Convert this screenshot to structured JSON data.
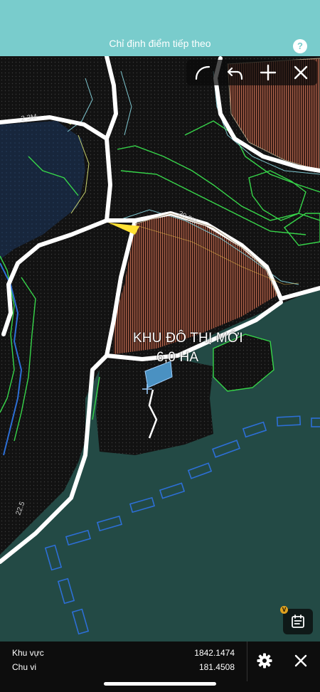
{
  "header": {
    "title": "Chỉ định điểm tiếp theo",
    "help_label": "?"
  },
  "toolbar": {
    "tools": [
      {
        "name": "arc-icon"
      },
      {
        "name": "undo-icon"
      },
      {
        "name": "plus-icon"
      },
      {
        "name": "close-icon"
      }
    ]
  },
  "map": {
    "area_title": "KHU ĐÔ THỊ MỚI",
    "area_size": "6,0 HA",
    "colors": {
      "water": "#21423f",
      "land": "#121212",
      "road": "#ffffff",
      "zone": "#b36b52",
      "contour": "#37d64a",
      "boundary": "#2d6fd6"
    }
  },
  "layers": {
    "badge": "V"
  },
  "footer": {
    "area_label": "Khu vực",
    "area_value": "1842.1474",
    "perimeter_label": "Chu vi",
    "perimeter_value": "181.4508"
  }
}
